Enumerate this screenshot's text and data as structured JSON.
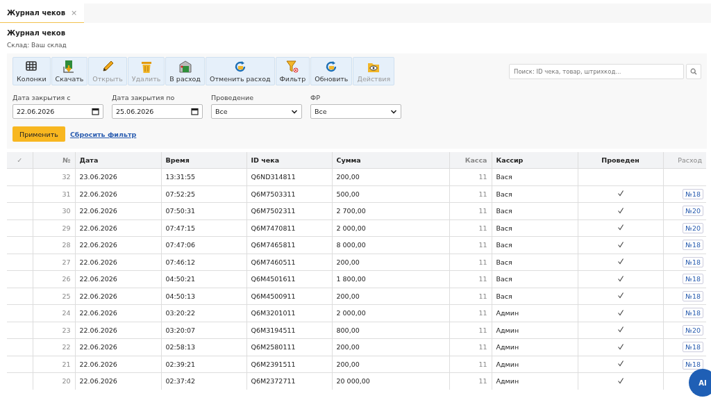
{
  "tabs": [
    {
      "label": "Журнал чеков",
      "selected": true,
      "close": "×"
    }
  ],
  "page": {
    "title": "Журнал чеков",
    "subtitle": "Склад: Ваш склад"
  },
  "toolbar": [
    {
      "kind": "columns",
      "label": "Колонки",
      "disabled": false
    },
    {
      "kind": "download",
      "label": "Скачать",
      "disabled": false
    },
    {
      "kind": "edit",
      "label": "Открыть",
      "disabled": true
    },
    {
      "kind": "delete",
      "label": "Удалить",
      "disabled": true
    },
    {
      "kind": "expense",
      "label": "В расход",
      "disabled": false
    },
    {
      "kind": "undo",
      "label": "Отменить расход",
      "disabled": false
    },
    {
      "kind": "filter",
      "label": "Фильтр",
      "disabled": false
    },
    {
      "kind": "refresh",
      "label": "Обновить",
      "disabled": false
    },
    {
      "kind": "actions",
      "label": "Действия",
      "disabled": true
    }
  ],
  "search": {
    "placeholder": "Поиск: ID чека, товар, штрихкод..."
  },
  "filters": [
    {
      "kind": "date",
      "label": "Дата закрытия с",
      "value": "22.06.2026"
    },
    {
      "kind": "date",
      "label": "Дата закрытия по",
      "value": "25.06.2026"
    },
    {
      "kind": "select",
      "label": "Проведение",
      "value": "Все"
    },
    {
      "kind": "select",
      "label": "ФР",
      "value": "Все"
    }
  ],
  "apply_button": "Применить",
  "reset_link": "Сбросить фильтр",
  "table": {
    "columns": [
      "✓",
      "№",
      "Дата",
      "Время",
      "ID чека",
      "Сумма",
      "Касса",
      "Кассир",
      "Проведен",
      "Расход"
    ],
    "rows": [
      {
        "num": "32",
        "date": "23.06.2026",
        "time": "13:31:55",
        "id": "Q6ND314811",
        "sum": "200,00",
        "till": "11",
        "cashier": "Вася",
        "posted": false
      },
      {
        "num": "31",
        "date": "22.06.2026",
        "time": "07:52:25",
        "id": "Q6M7503311",
        "sum": "500,00",
        "till": "11",
        "cashier": "Вася",
        "posted": true,
        "expense": "№18"
      },
      {
        "num": "30",
        "date": "22.06.2026",
        "time": "07:50:31",
        "id": "Q6M7502311",
        "sum": "2 700,00",
        "till": "11",
        "cashier": "Вася",
        "posted": true,
        "expense": "№20"
      },
      {
        "num": "29",
        "date": "22.06.2026",
        "time": "07:47:15",
        "id": "Q6M7470811",
        "sum": "2 000,00",
        "till": "11",
        "cashier": "Вася",
        "posted": true,
        "expense": "№20"
      },
      {
        "num": "28",
        "date": "22.06.2026",
        "time": "07:47:06",
        "id": "Q6M7465811",
        "sum": "8 000,00",
        "till": "11",
        "cashier": "Вася",
        "posted": true,
        "expense": "№18"
      },
      {
        "num": "27",
        "date": "22.06.2026",
        "time": "07:46:12",
        "id": "Q6M7460511",
        "sum": "200,00",
        "till": "11",
        "cashier": "Вася",
        "posted": true,
        "expense": "№18"
      },
      {
        "num": "26",
        "date": "22.06.2026",
        "time": "04:50:21",
        "id": "Q6M4501611",
        "sum": "1 800,00",
        "till": "11",
        "cashier": "Вася",
        "posted": true,
        "expense": "№18"
      },
      {
        "num": "25",
        "date": "22.06.2026",
        "time": "04:50:13",
        "id": "Q6M4500911",
        "sum": "200,00",
        "till": "11",
        "cashier": "Вася",
        "posted": true,
        "expense": "№18"
      },
      {
        "num": "24",
        "date": "22.06.2026",
        "time": "03:20:22",
        "id": "Q6M3201011",
        "sum": "2 000,00",
        "till": "11",
        "cashier": "Админ",
        "posted": true,
        "expense": "№18"
      },
      {
        "num": "23",
        "date": "22.06.2026",
        "time": "03:20:07",
        "id": "Q6M3194511",
        "sum": "800,00",
        "till": "11",
        "cashier": "Админ",
        "posted": true,
        "expense": "№20"
      },
      {
        "num": "22",
        "date": "22.06.2026",
        "time": "02:58:13",
        "id": "Q6M2580111",
        "sum": "200,00",
        "till": "11",
        "cashier": "Админ",
        "posted": true,
        "expense": "№18"
      },
      {
        "num": "21",
        "date": "22.06.2026",
        "time": "02:39:21",
        "id": "Q6M2391511",
        "sum": "200,00",
        "till": "11",
        "cashier": "Админ",
        "posted": true,
        "expense": "№18"
      },
      {
        "num": "20",
        "date": "22.06.2026",
        "time": "02:37:42",
        "id": "Q6M2372711",
        "sum": "20 000,00",
        "till": "11",
        "cashier": "Админ",
        "posted": true
      }
    ]
  },
  "ai_button": "AI"
}
